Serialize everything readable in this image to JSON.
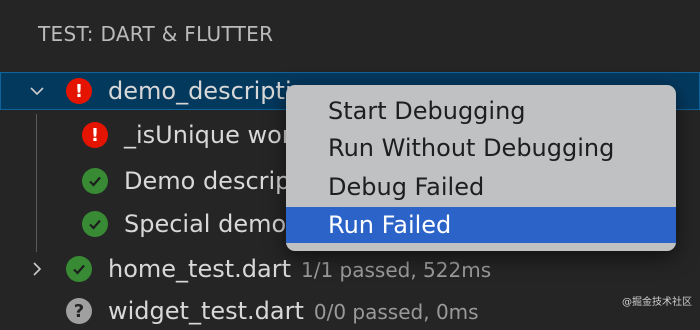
{
  "panel": {
    "title": "TEST: DART & FLUTTER"
  },
  "tree": {
    "group1": {
      "label": "demo_descripti",
      "desc": "",
      "status": "fail"
    },
    "children": [
      {
        "label": "_isUnique wor",
        "status": "fail"
      },
      {
        "label": "Demo descrip",
        "status": "pass"
      },
      {
        "label": "Special demo",
        "status": "pass"
      }
    ],
    "group2": {
      "label": "home_test.dart",
      "desc": "1/1 passed, 522ms",
      "status": "pass"
    },
    "group3": {
      "label": "widget_test.dart",
      "desc": "0/0 passed, 0ms",
      "status": "unknown"
    }
  },
  "context_menu": {
    "items": [
      "Start Debugging",
      "Run Without Debugging",
      "Debug Failed",
      "Run Failed"
    ],
    "active_index": 3
  },
  "watermark": "@掘金技术社区",
  "colors": {
    "background": "#252526",
    "selection": "#04395e",
    "fail": "#e51400",
    "pass": "#388a34",
    "menu_active": "#2c63c9"
  }
}
